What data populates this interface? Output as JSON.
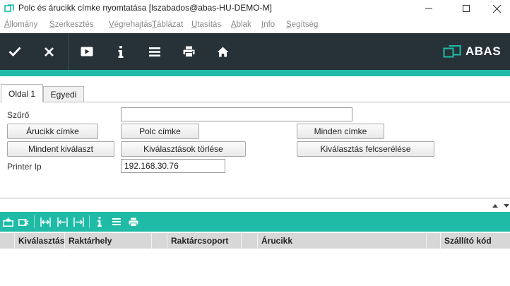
{
  "window": {
    "title": "Polc és árucikk címke nyomtatása  [lszabados@abas-HU-DEMO-M]",
    "controls": {
      "minimize": "—",
      "maximize": "☐",
      "close": "✕"
    }
  },
  "menubar": {
    "items": [
      {
        "first": "Á",
        "rest": "llomány"
      },
      {
        "first": "S",
        "rest": "zerkesztés"
      },
      {
        "first": "V",
        "rest": "égrehajtás"
      },
      {
        "first": "T",
        "rest": "áblázat"
      },
      {
        "first": "U",
        "rest": "tasítás"
      },
      {
        "first": "A",
        "rest": "blak"
      },
      {
        "first": "I",
        "rest": "nfo"
      },
      {
        "first": "S",
        "rest": "egítség"
      }
    ]
  },
  "toolbar": {
    "brand": "ABAS",
    "icons": [
      "check-icon",
      "close-icon",
      "play-icon",
      "info-icon",
      "menu-icon",
      "printer-icon",
      "home-icon"
    ]
  },
  "tabs": [
    {
      "label": "Oldal 1",
      "active": true
    },
    {
      "label": "Egyedi",
      "active": false
    }
  ],
  "form": {
    "filter_label": "Szűrő",
    "filter_value": "",
    "btn_article_label": "Árucikk címke",
    "btn_shelf_label": "Polc címke",
    "btn_all_labels": "Minden címke",
    "btn_select_all": "Mindent kiválaszt",
    "btn_clear_selection": "Kiválasztások törlése",
    "btn_swap_selection": "Kiválasztás felcserélése",
    "printer_label": "Printer Ip",
    "printer_value": "192.168.30.76"
  },
  "subtoolbar": {
    "icons": [
      "insert-row-icon",
      "delete-row-icon",
      "fit-columns-icon",
      "shrink-column-icon",
      "expand-column-icon",
      "info-icon",
      "menu-icon",
      "printer-icon"
    ]
  },
  "table": {
    "columns": [
      "Kiválasztás",
      "Raktárhely",
      "Raktárcsoport",
      "Árucikk",
      "Szállító kód"
    ]
  },
  "colors": {
    "toolbar_bg": "#263238",
    "accent": "#1fbba6",
    "table_header_bg": "#d7d7d7"
  }
}
